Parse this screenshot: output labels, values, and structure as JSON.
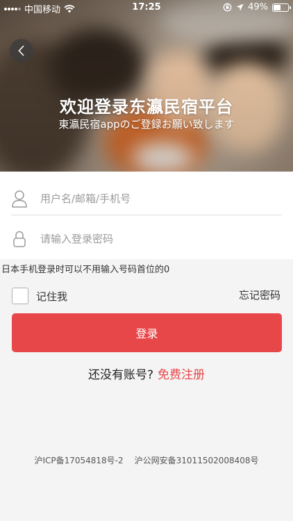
{
  "status_bar": {
    "carrier": "中国移动",
    "time": "17:25",
    "battery_percent": "49%",
    "battery_level": 0.49
  },
  "header": {
    "back_icon": "chevron-left-icon",
    "title": "欢迎登录东瀛民宿平台",
    "subtitle": "東瀛民宿appのご登録お願い致します"
  },
  "form": {
    "username": {
      "icon": "user-icon",
      "placeholder": "用户名/邮箱/手机号",
      "value": ""
    },
    "password": {
      "icon": "lock-icon",
      "placeholder": "请输入登录密码",
      "value": ""
    },
    "hint": "日本手机登录时可以不用输入号码首位的0",
    "remember_label": "记住我",
    "remember_checked": false,
    "forgot_label": "忘记密码",
    "login_label": "登录"
  },
  "register": {
    "question": "还没有账号?",
    "link": "免费注册"
  },
  "footer": {
    "icp": "沪ICP备17054818号-2",
    "police": "沪公网安备31011502008408号"
  },
  "colors": {
    "accent": "#e8474a",
    "background": "#f4f4f4"
  }
}
